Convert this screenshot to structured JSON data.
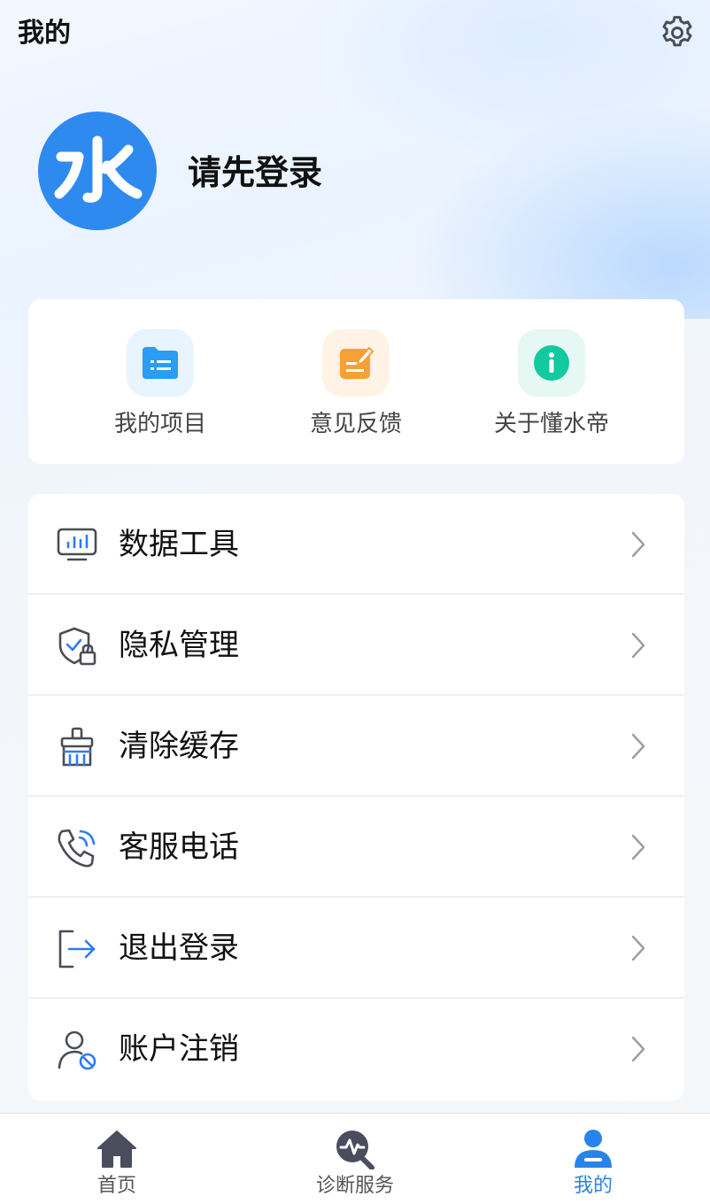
{
  "header": {
    "title": "我的",
    "settings_icon": "gear-icon"
  },
  "profile": {
    "avatar_glyph": "水",
    "login_prompt": "请先登录"
  },
  "quick_actions": [
    {
      "label": "我的项目",
      "icon": "folder-list-icon",
      "color": "#2a9df4",
      "bg": "#e8f4fe"
    },
    {
      "label": "意见反馈",
      "icon": "feedback-edit-icon",
      "color": "#f7a035",
      "bg": "#fff3e6"
    },
    {
      "label": "关于懂水帝",
      "icon": "info-icon",
      "color": "#13c9a0",
      "bg": "#e5f8f3"
    }
  ],
  "menu": [
    {
      "label": "数据工具",
      "icon": "monitor-chart-icon"
    },
    {
      "label": "隐私管理",
      "icon": "shield-lock-icon"
    },
    {
      "label": "清除缓存",
      "icon": "broom-icon"
    },
    {
      "label": "客服电话",
      "icon": "phone-icon"
    },
    {
      "label": "退出登录",
      "icon": "logout-icon"
    },
    {
      "label": "账户注销",
      "icon": "user-cancel-icon"
    }
  ],
  "tabs": [
    {
      "label": "首页",
      "icon": "home-icon",
      "active": false
    },
    {
      "label": "诊断服务",
      "icon": "diagnosis-icon",
      "active": false
    },
    {
      "label": "我的",
      "icon": "user-icon",
      "active": true
    }
  ],
  "colors": {
    "accent": "#2784ea",
    "avatar_bg": "#2f8af0",
    "icon_gray": "#4a4d55"
  }
}
